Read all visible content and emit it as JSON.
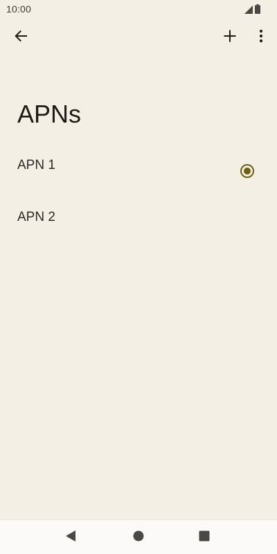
{
  "status_bar": {
    "time": "10:00",
    "icons": [
      "signal-icon",
      "battery-icon"
    ]
  },
  "toolbar": {
    "back_icon": "arrow-back-icon",
    "add_icon": "plus-icon",
    "more_icon": "more-vert-icon"
  },
  "page": {
    "title": "APNs"
  },
  "apns": [
    {
      "label": "APN 1",
      "selected": true
    },
    {
      "label": "APN 2",
      "selected": false
    }
  ],
  "nav_bar": {
    "icons": [
      "nav-back-icon",
      "nav-home-icon",
      "nav-recents-icon"
    ]
  },
  "colors": {
    "background": "#f4efe4",
    "radio_accent": "#6b5e10",
    "nav_bar_bg": "#fbfaf8",
    "text_primary": "#1d1b16"
  }
}
